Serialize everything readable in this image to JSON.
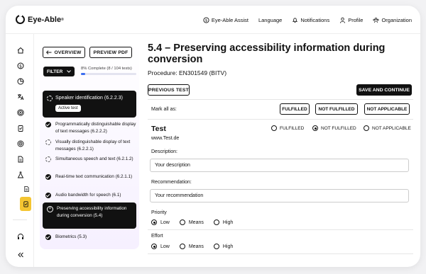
{
  "app": {
    "name": "Eye-Able",
    "trademark": "®"
  },
  "topnav": [
    {
      "label": "Eye-Able Assist",
      "icon": "assist-icon"
    },
    {
      "label": "Language",
      "icon": ""
    },
    {
      "label": "Notifications",
      "icon": "bell-icon"
    },
    {
      "label": "Profile",
      "icon": "user-icon"
    },
    {
      "label": "Organization",
      "icon": "organization-icon"
    }
  ],
  "list": {
    "overview_label": "OVERVIEW",
    "preview_label": "PREVIEW PDF",
    "filter_label": "FILTER",
    "progress_text": "8% Complete (8 / 104 tests)",
    "progress_fraction": 0.08,
    "active_item": {
      "title": "Speaker identification (6.2.2.3)",
      "badge": "Active test"
    },
    "items": [
      {
        "text": "Programmatically distinguishable display of text messages (6.2.2.2)",
        "status": "done"
      },
      {
        "text": "Visually distinguishable display of text messages (6.2.2.1)",
        "status": "pending"
      },
      {
        "text": "Simultaneous speech and text (6.2.1.2)",
        "status": "pending"
      },
      {
        "text": "Real-time text communication (6.2.1.1)",
        "status": "done"
      },
      {
        "text": "Audio bandwidth for speech (6.1)",
        "status": "done"
      }
    ],
    "selected_item": {
      "text": "Preserving accessibility information during conversion (5.4)"
    },
    "last_item": {
      "text": "Biometrics (5.3)",
      "status": "done"
    }
  },
  "main": {
    "title": "5.4 – Preserving accessibility information during conversion",
    "procedure": "Procedure: EN301549 (BITV)",
    "previous_label": "PREVIOUS TEST",
    "save_label": "SAVE AND CONTINUE",
    "mark_all_label": "Mark all as:",
    "mark_buttons": [
      "FULFILLED",
      "NOT FULFILLED",
      "NOT APPLICABLE"
    ],
    "test_title": "Test",
    "test_url": "www.Test.de",
    "test_options": [
      "FULFILLED",
      "NOT FULFILLED",
      "NOT APPLICABLE"
    ],
    "test_selected": "NOT FULFILLED",
    "description_label": "Description:",
    "description_value": "Your description",
    "recommendation_label": "Recommendation:",
    "recommendation_value": "Your recommendation",
    "priority_label": "Priority",
    "priority_options": [
      "Low",
      "Means",
      "High"
    ],
    "priority_selected": "Low",
    "effort_label": "Effort",
    "effort_options": [
      "Low",
      "Means",
      "High"
    ],
    "effort_selected": "Low"
  },
  "colors": {
    "accent": "#f4c531",
    "progress": "#3c6df0",
    "dark": "#111111"
  }
}
